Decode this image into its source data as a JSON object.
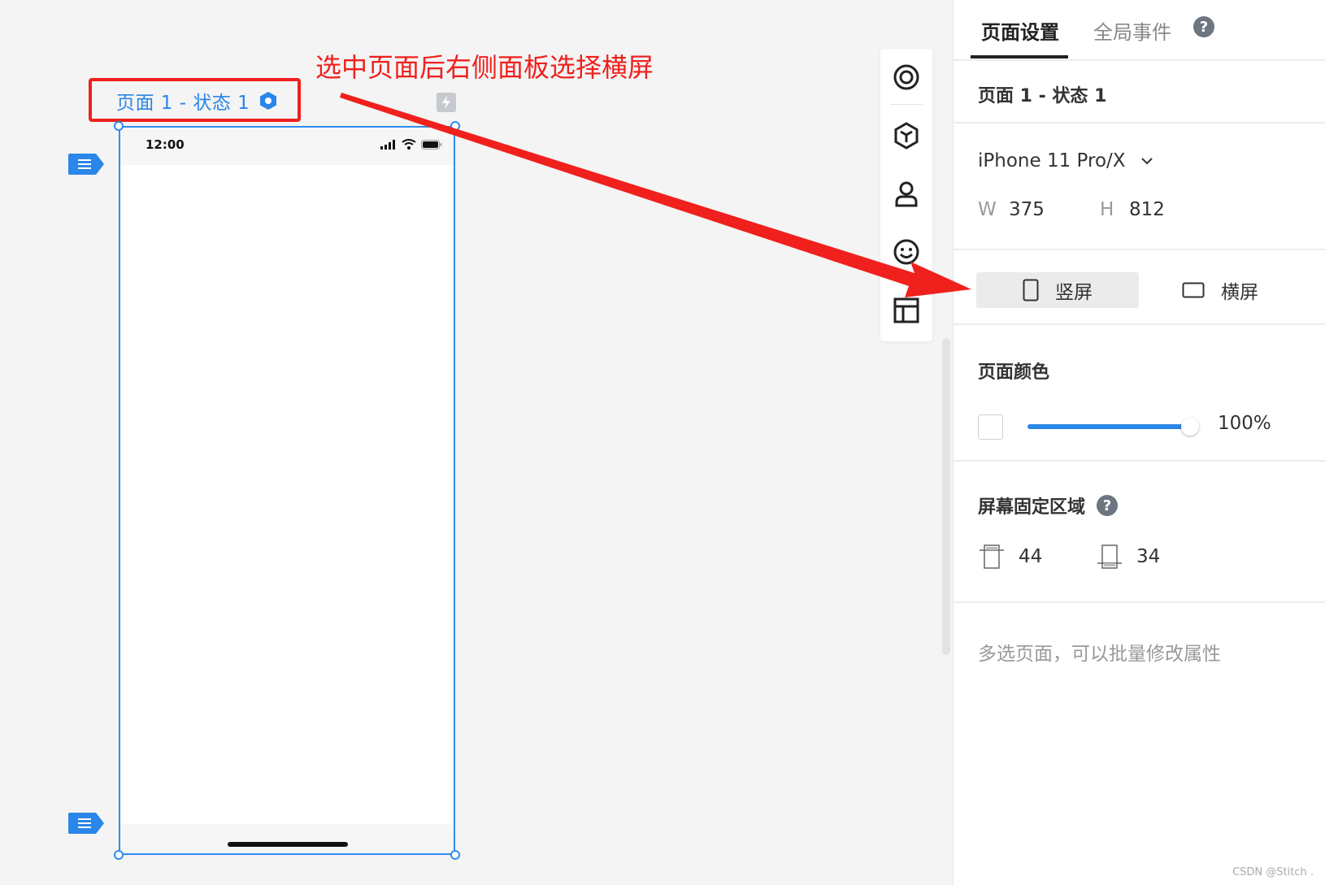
{
  "canvas": {
    "page_label": "页面 1 - 状态 1",
    "annotation": "选中页面后右侧面板选择横屏",
    "status_time": "12:00"
  },
  "toolbar": {
    "tools": [
      "target-icon",
      "component-icon",
      "user-icon",
      "smiley-icon",
      "layout-icon"
    ]
  },
  "panel": {
    "tabs": [
      "页面设置",
      "全局事件"
    ],
    "active_tab": "页面设置",
    "page_name": "页面 1 - 状态 1",
    "device": "iPhone 11 Pro/X",
    "width_label": "W",
    "width": "375",
    "height_label": "H",
    "height": "812",
    "orientation": {
      "portrait": "竖屏",
      "landscape": "横屏",
      "selected": "portrait"
    },
    "page_color": {
      "title": "页面颜色",
      "swatch": "#ffffff",
      "opacity_text": "100%",
      "opacity": 1.0
    },
    "fixed_area": {
      "title": "屏幕固定区域",
      "top": "44",
      "bottom": "34"
    },
    "multi_select_hint": "多选页面，可以批量修改属性"
  },
  "watermark": "CSDN @Stitch .",
  "colors": {
    "accent": "#2a86e8",
    "annotation_red": "#f0201d"
  }
}
